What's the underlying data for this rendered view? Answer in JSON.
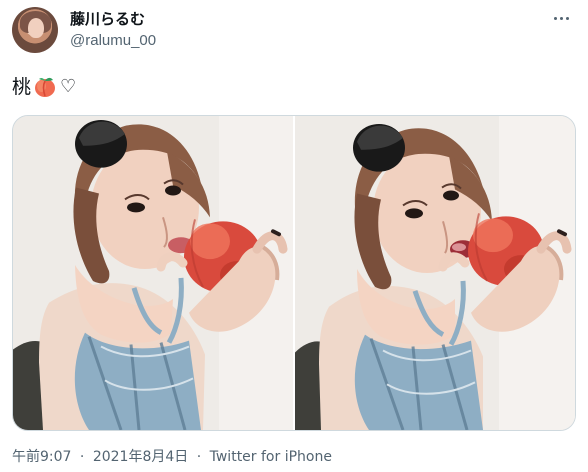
{
  "author": {
    "display_name": "藤川らるむ",
    "username": "@ralumu_00",
    "avatar_icon": "profile-avatar"
  },
  "actions": {
    "more_icon": "more-horizontal-icon"
  },
  "tweet": {
    "text_prefix": "桃",
    "emoji": "peach-icon",
    "text_suffix": "♡"
  },
  "media": [
    {
      "label": "photo-1",
      "subject": "woman holding peach"
    },
    {
      "label": "photo-2",
      "subject": "woman biting peach"
    }
  ],
  "meta": {
    "time": "午前9:07",
    "separator": "·",
    "date": "2021年8月4日",
    "source": "Twitter for iPhone"
  },
  "colors": {
    "text": "#0f1419",
    "muted": "#536471",
    "border": "#cfd9de",
    "peach": "#d94a3d",
    "peach_highlight": "#f47b63"
  }
}
